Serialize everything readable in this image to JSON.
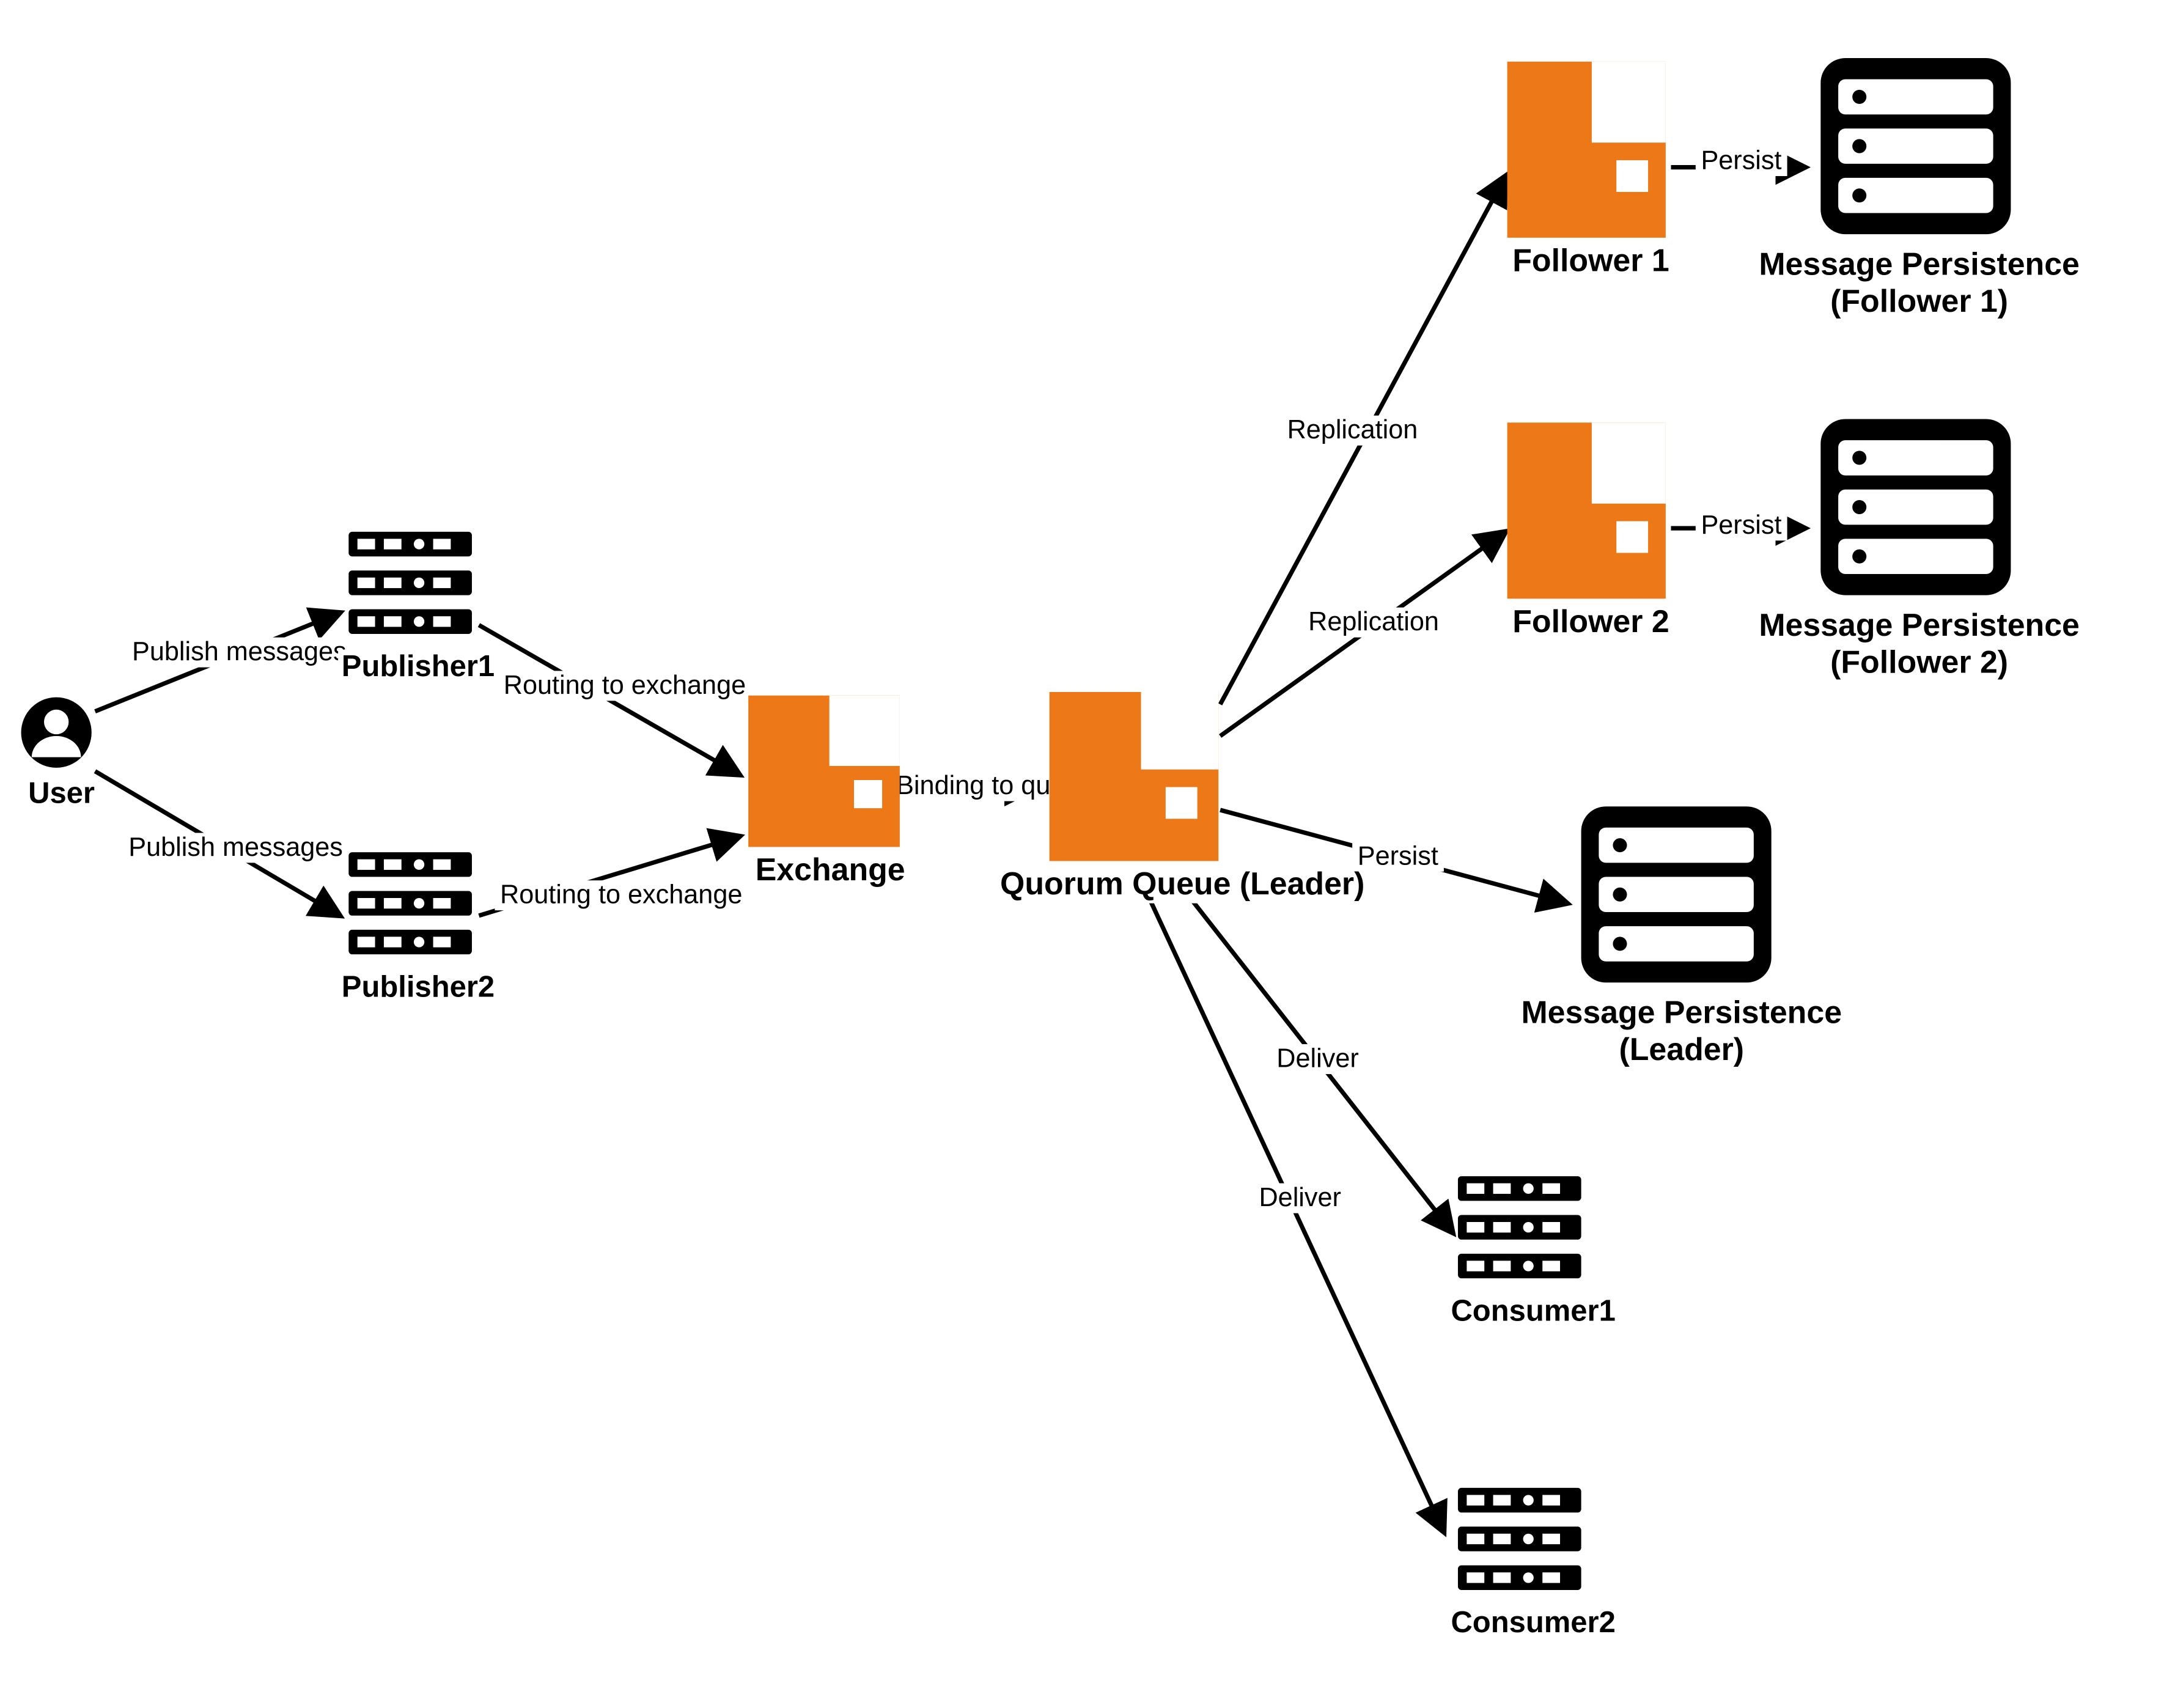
{
  "nodes": {
    "user": "User",
    "publisher1": "Publisher1",
    "publisher2": "Publisher2",
    "exchange": "Exchange",
    "leader": "Quorum Queue (Leader)",
    "follower1": "Follower 1",
    "follower2": "Follower 2",
    "persist_f1_l1": "Message Persistence",
    "persist_f1_l2": "(Follower 1)",
    "persist_f2_l1": "Message Persistence",
    "persist_f2_l2": "(Follower 2)",
    "persist_leader_l1": "Message Persistence",
    "persist_leader_l2": "(Leader)",
    "consumer1": "Consumer1",
    "consumer2": "Consumer2"
  },
  "edges": {
    "user_pub1": "Publish messages",
    "user_pub2": "Publish messages",
    "pub1_ex": "Routing to exchange",
    "pub2_ex": "Routing to exchange",
    "ex_leader": "Binding to queue",
    "leader_f1": "Replication",
    "leader_f2": "Replication",
    "leader_persist": "Persist",
    "f1_persist": "Persist",
    "f2_persist": "Persist",
    "leader_c1": "Deliver",
    "leader_c2": "Deliver"
  }
}
